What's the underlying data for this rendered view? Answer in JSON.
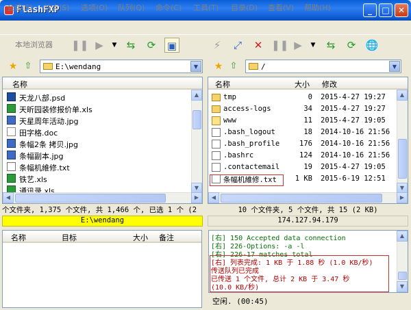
{
  "window": {
    "title": "FlashFXP"
  },
  "menu": [
    "会话(S)",
    "站点(S)",
    "选项(O)",
    "队列(Q)",
    "命令(C)",
    "工具(T)",
    "目录(D)",
    "查看(V)",
    "帮助(H)"
  ],
  "toolbar": {
    "local_browser": "本地浏览器"
  },
  "local": {
    "path": "E:\\wendang",
    "col_name": "名称",
    "files": [
      {
        "name": "天龙八部.psd",
        "icon": "psd"
      },
      {
        "name": "天昕园装修报价单.xls",
        "icon": "xls"
      },
      {
        "name": "天星周年活动.jpg",
        "icon": "jpg"
      },
      {
        "name": "田字格.doc",
        "icon": "doc"
      },
      {
        "name": "条幅2条 拷贝.jpg",
        "icon": "jpg"
      },
      {
        "name": "条幅副本.jpg",
        "icon": "jpg"
      },
      {
        "name": "条幅机維修.txt",
        "icon": "txt"
      },
      {
        "name": "铁艺.xls",
        "icon": "xls"
      },
      {
        "name": "通讯录.xls",
        "icon": "xls"
      }
    ],
    "status": "个文件夹, 1,375 个文件, 共 1,466 个, 已选 1 个 (2",
    "status_path": "E:\\wendang"
  },
  "remote": {
    "path": "/",
    "col_name": "名称",
    "col_size": "大小",
    "col_modified": "修改",
    "files": [
      {
        "name": "tmp",
        "size": "0",
        "date": "2015-4-27 19:27",
        "icon": "fold"
      },
      {
        "name": "access-logs",
        "size": "34",
        "date": "2015-4-27 19:27",
        "icon": "fold"
      },
      {
        "name": "www",
        "size": "11",
        "date": "2015-4-27 19:05",
        "icon": "www"
      },
      {
        "name": ".bash_logout",
        "size": "18",
        "date": "2014-10-16 21:56",
        "icon": "txt"
      },
      {
        "name": ".bash_profile",
        "size": "176",
        "date": "2014-10-16 21:56",
        "icon": "txt"
      },
      {
        "name": ".bashrc",
        "size": "124",
        "date": "2014-10-16 21:56",
        "icon": "txt"
      },
      {
        "name": ".contactemail",
        "size": "19",
        "date": "2015-4-27 19:05",
        "icon": "txt"
      },
      {
        "name": "条幅机維修.txt",
        "size": "1 KB",
        "date": "2015-6-19 12:51",
        "icon": "txt"
      }
    ],
    "status": "10 个文件夹, 5 个文件, 共 15 (2 KB)",
    "status_host": "174.127.94.179"
  },
  "queue": {
    "col_name": "名称",
    "col_target": "目标",
    "col_size": "大小",
    "col_note": "备注"
  },
  "log": [
    {
      "text": "[右] 150 Accepted data connection",
      "color": "#007000"
    },
    {
      "text": "[右] 226-Options: -a -l",
      "color": "#007000"
    },
    {
      "text": "[右] 226-17 matches total",
      "color": "#007000"
    },
    {
      "text": "[右] 列表完成: 1 KB 于 1.88 秒 (1.0 KB/秒)",
      "color": "#b00000"
    },
    {
      "text": "传送队列已完成",
      "color": "#b00000"
    },
    {
      "text": "已传送 1 个文件, 总计 2 KB 于 3.47 秒",
      "color": "#b00000"
    },
    {
      "text": "(10.0 KB/秒)",
      "color": "#b00000"
    }
  ],
  "idle": "空闲. (00:45)"
}
